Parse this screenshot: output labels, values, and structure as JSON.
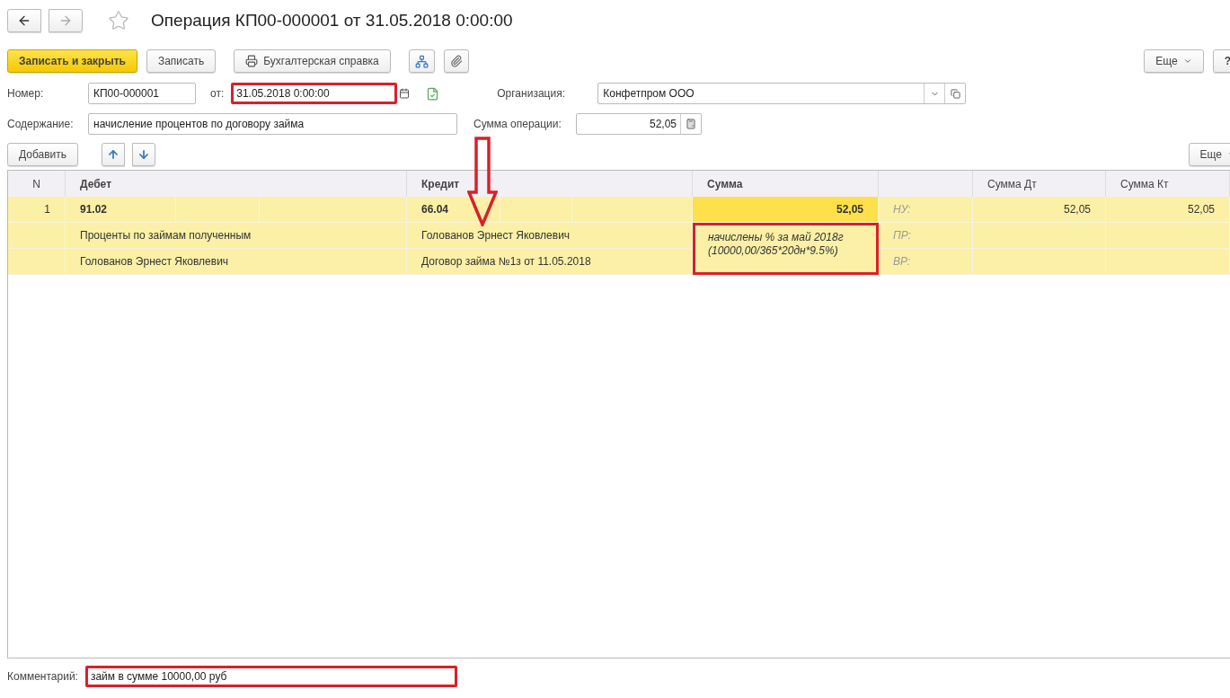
{
  "window": {
    "title": "Операция КП00-000001 от 31.05.2018 0:00:00",
    "favorite": false
  },
  "toolbar": {
    "buttons": [
      {
        "kind": "primary",
        "label": "Записать и закрыть"
      },
      {
        "kind": "normal",
        "label": "Записать"
      },
      {
        "kind": "print",
        "label": "Бухгалтерская справка"
      },
      {
        "kind": "structure"
      },
      {
        "kind": "attach"
      }
    ],
    "more": "Еще",
    "help": "?"
  },
  "header": {
    "number": {
      "label": "Номер:",
      "value": "КП00-000001"
    },
    "date": {
      "label": "от:",
      "value": "31.05.2018  0:00:00",
      "highlighted": true
    },
    "organization": {
      "label": "Организация:",
      "value": "Конфетпром ООО"
    },
    "content": {
      "label": "Содержание:",
      "value": "начисление процентов по договору займа"
    },
    "amount": {
      "label": "Сумма операции:",
      "value": "52,05"
    }
  },
  "table_toolbar": {
    "add": "Добавить",
    "more": "Еще"
  },
  "table": {
    "columns": [
      {
        "label": "N",
        "bold": false
      },
      {
        "label": "Дебет",
        "bold": true
      },
      {
        "label": "Кредит",
        "bold": true
      },
      {
        "label": "Сумма",
        "bold": true
      },
      {
        "label": "Сумма Дт",
        "bold": false
      },
      {
        "label": "Сумма Кт",
        "bold": false
      }
    ],
    "rows": [
      {
        "n": "1",
        "selected": true,
        "debit": {
          "account": "91.02",
          "subconto": [
            "Проценты по займам полученным",
            "Голованов Эрнест Яковлевич"
          ]
        },
        "credit": {
          "account": "66.04",
          "subconto": [
            "Голованов Эрнест Яковлевич",
            "Договор займа №1з от 11.05.2018"
          ]
        },
        "sum": "52,05",
        "sum_note": "начислены % за май 2018г (10000,00/365*20дн*9.5%)",
        "sum_note_highlighted": true,
        "tax": [
          {
            "label": "НУ:",
            "dt": "52,05",
            "kt": "52,05"
          },
          {
            "label": "ПР:"
          },
          {
            "label": "ВР:"
          }
        ]
      }
    ]
  },
  "comment": {
    "label": "Комментарий:",
    "value": "займ в сумме 10000,00 руб",
    "highlighted": true
  },
  "annotation": {
    "arrow": true
  }
}
